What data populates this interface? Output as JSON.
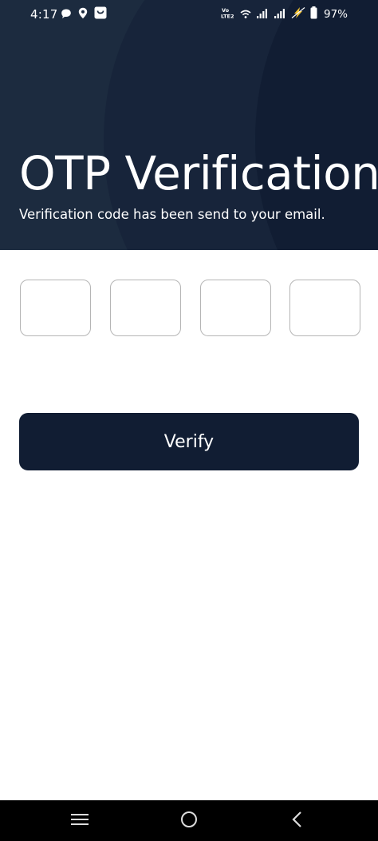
{
  "status_bar": {
    "time": "4:17",
    "network_label": "Vo LTE2",
    "battery_percent": "97%",
    "left_icons": [
      "chat-bubble-icon",
      "location-pin-icon",
      "shopping-bag-icon"
    ],
    "right_icons": [
      "volte-icon",
      "wifi-icon",
      "signal-icon",
      "signal-icon",
      "charging-icon",
      "battery-icon"
    ]
  },
  "header": {
    "title": "OTP Verification",
    "subtitle": "Verification code has been send to your email."
  },
  "otp": {
    "boxes": [
      "",
      "",
      "",
      ""
    ]
  },
  "actions": {
    "verify_label": "Verify"
  },
  "navigation": {
    "buttons": [
      "menu-icon",
      "home-icon",
      "back-icon"
    ]
  },
  "colors": {
    "header_bg": "#1a2538",
    "button_bg": "#111d33",
    "otp_border": "#b5b5b5",
    "text_on_dark": "#ffffff",
    "nav_bar_bg": "#000000"
  }
}
